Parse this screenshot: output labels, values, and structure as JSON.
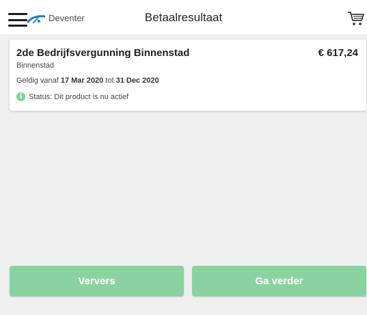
{
  "header": {
    "city": "Deventer",
    "title": "Betaalresultaat",
    "menu_icon": "hamburger-menu-icon",
    "logo_icon": "city-logo-icon",
    "cart_icon": "shopping-cart-icon"
  },
  "product": {
    "name": "2de Bedrijfsvergunning Binnenstad",
    "price": "€ 617,24",
    "zone": "Binnenstad",
    "valid_from_label": "Geldig vanaf",
    "valid_from": "17 Mar 2020",
    "valid_to_label": "tot",
    "valid_to": "31 Dec 2020",
    "status": "Status: Dit product is nu actief",
    "status_icon": "info-icon"
  },
  "actions": {
    "refresh_label": "Ververs",
    "continue_label": "Ga verder"
  },
  "colors": {
    "accent": "#8ad3a1",
    "status_icon": "#7ecf97",
    "background": "#efefef"
  }
}
